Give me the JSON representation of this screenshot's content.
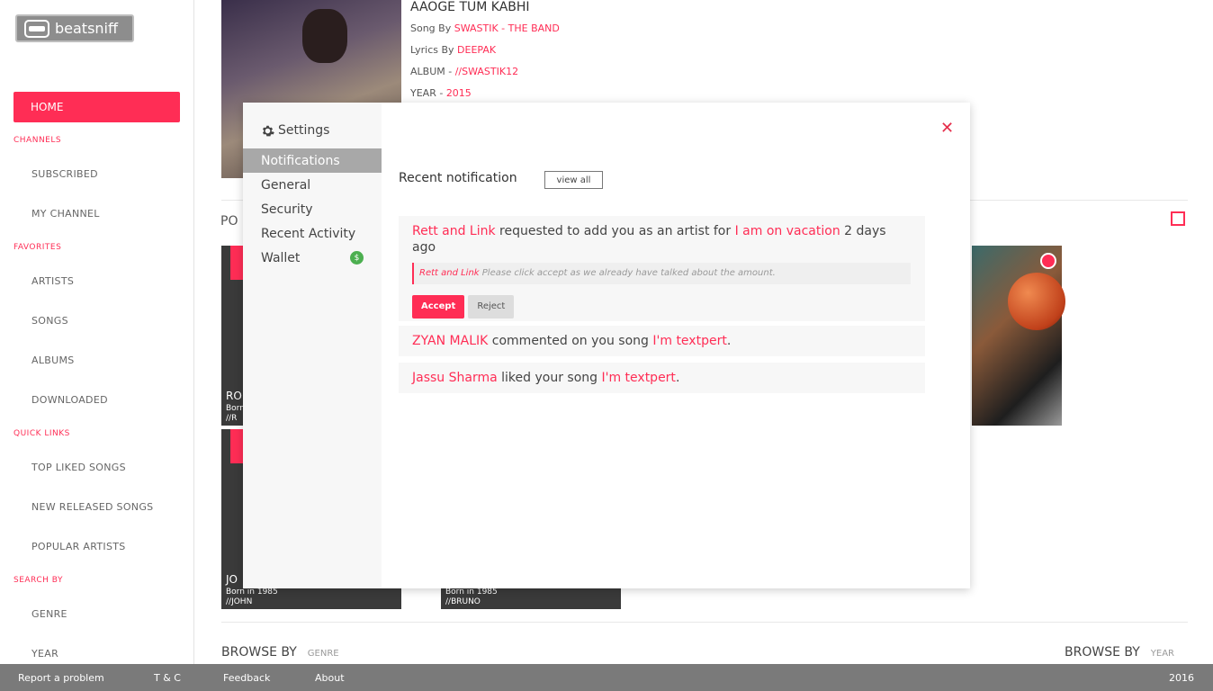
{
  "logo": {
    "text": "beatsniff"
  },
  "sidebar": {
    "home": "HOME",
    "sections": [
      {
        "title": "CHANNELS",
        "items": [
          "SUBSCRIBED",
          "MY CHANNEL"
        ]
      },
      {
        "title": "FAVORITES",
        "items": [
          "ARTISTS",
          "SONGS",
          "ALBUMS",
          "DOWNLOADED"
        ]
      },
      {
        "title": "QUICK LINKS",
        "items": [
          "TOP LIKED SONGS",
          "NEW RELEASED SONGS",
          "POPULAR ARTISTS"
        ]
      },
      {
        "title": "SEARCH BY",
        "items": [
          "GENRE",
          "YEAR"
        ]
      }
    ]
  },
  "song": {
    "title": "AAOGE TUM KABHI",
    "song_by_label": "Song By",
    "song_by": "SWASTIK - THE BAND",
    "lyrics_label": "Lyrics By",
    "lyrics_by": "DEEPAK",
    "album_label": "ALBUM -",
    "album": "//SWASTIK12",
    "year_label": "YEAR -",
    "year": "2015"
  },
  "popular_label": "PO",
  "cards": [
    {
      "name": "RO",
      "born": "Born",
      "handle": "//R"
    },
    {
      "name": "JO",
      "born": "Born in 1985",
      "handle": "//JOHN"
    },
    {
      "name": "",
      "born": "Born in 1985",
      "handle": "//BRUNO"
    }
  ],
  "browse": {
    "label": "BROWSE BY",
    "left_sub": "GENRE",
    "right_sub": "YEAR"
  },
  "footer": {
    "report": "Report a problem",
    "tc": "T & C",
    "feedback": "Feedback",
    "about": "About",
    "year": "2016"
  },
  "settings": {
    "title": "Settings",
    "menu": [
      "Notifications",
      "General",
      "Security",
      "Recent Activity",
      "Wallet"
    ],
    "wallet_badge": "$",
    "close": "✕",
    "recent_label": "Recent notification",
    "view_all": "view all",
    "notifications": [
      {
        "actor": "Rett and Link",
        "text": " requested to add you as an artist for ",
        "target": "I am on vacation",
        "time": " 2 days ago",
        "quote_actor": "Rett and Link",
        "quote_text": " Please click accept as we already have talked about the amount.",
        "accept": "Accept",
        "reject": "Reject"
      },
      {
        "actor": "ZYAN MALIK",
        "text": " commented on you song ",
        "target": "I'm textpert",
        "end": "."
      },
      {
        "actor": "Jassu Sharma",
        "text": " liked your song ",
        "target": "I'm textpert",
        "end": "."
      }
    ]
  },
  "colors": {
    "accent": "#ff2d55",
    "footer": "#7a7a7a"
  }
}
